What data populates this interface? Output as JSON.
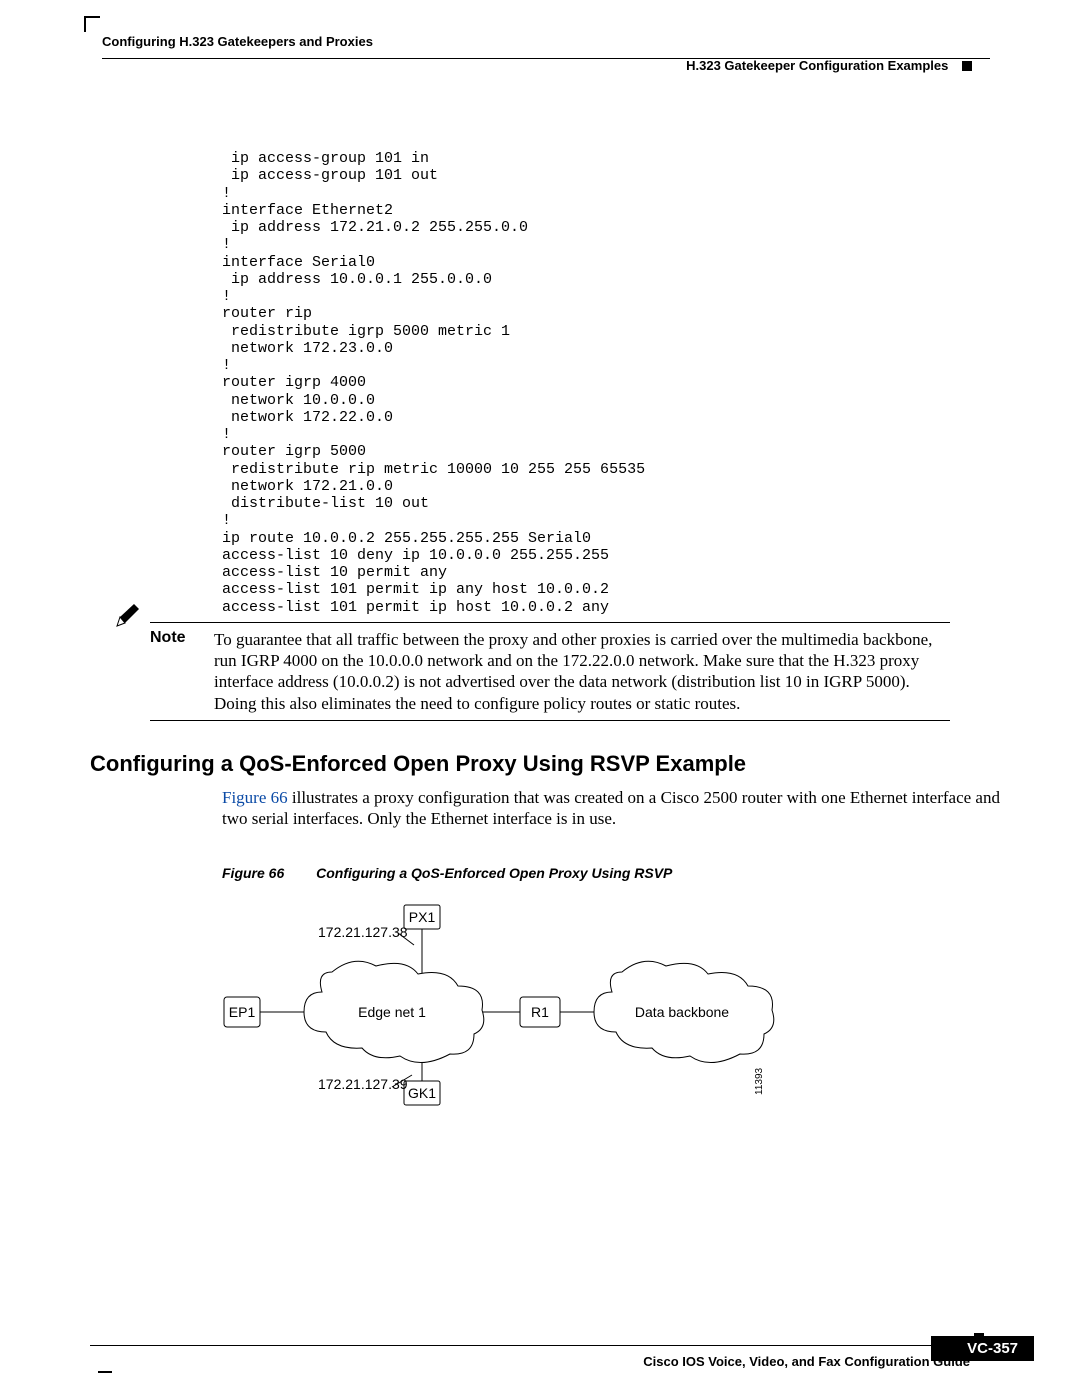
{
  "header": {
    "left": "Configuring H.323 Gatekeepers and Proxies",
    "right": "H.323 Gatekeeper Configuration Examples"
  },
  "code": " ip access-group 101 in\n ip access-group 101 out\n!\ninterface Ethernet2\n ip address 172.21.0.2 255.255.0.0\n!\ninterface Serial0\n ip address 10.0.0.1 255.0.0.0\n!\nrouter rip\n redistribute igrp 5000 metric 1\n network 172.23.0.0\n!\nrouter igrp 4000\n network 10.0.0.0\n network 172.22.0.0\n!\nrouter igrp 5000\n redistribute rip metric 10000 10 255 255 65535\n network 172.21.0.0\n distribute-list 10 out\n!\nip route 10.0.0.2 255.255.255.255 Serial0\naccess-list 10 deny ip 10.0.0.0 255.255.255\naccess-list 10 permit any\naccess-list 101 permit ip any host 10.0.0.2\naccess-list 101 permit ip host 10.0.0.2 any",
  "note": {
    "label": "Note",
    "text": "To guarantee that all traffic between the proxy and other proxies is carried over the multimedia backbone, run IGRP 4000 on the 10.0.0.0 network and on the 172.22.0.0 network. Make sure that the H.323 proxy interface address (10.0.0.2) is not advertised over the data network (distribution list 10 in IGRP 5000). Doing this also eliminates the need to configure policy routes or static routes."
  },
  "section": {
    "title": "Configuring a QoS-Enforced Open Proxy Using RSVP Example",
    "linkText": "Figure 66",
    "paraRest": " illustrates a proxy configuration that was created on a Cisco 2500 router with one Ethernet interface and two serial interfaces. Only the Ethernet interface is in use."
  },
  "figure": {
    "number": "Figure 66",
    "title": "Configuring a QoS-Enforced Open Proxy Using RSVP",
    "labels": {
      "px1": "PX1",
      "ep1": "EP1",
      "r1": "R1",
      "gk1": "GK1",
      "edgeNet": "Edge net 1",
      "dataBackbone": "Data backbone",
      "ip1": "172.21.127.38",
      "ip2": "172.21.127.39",
      "id": "11393"
    }
  },
  "footer": {
    "guide": "Cisco IOS Voice, Video, and Fax Configuration Guide",
    "pageNum": "VC-357"
  }
}
